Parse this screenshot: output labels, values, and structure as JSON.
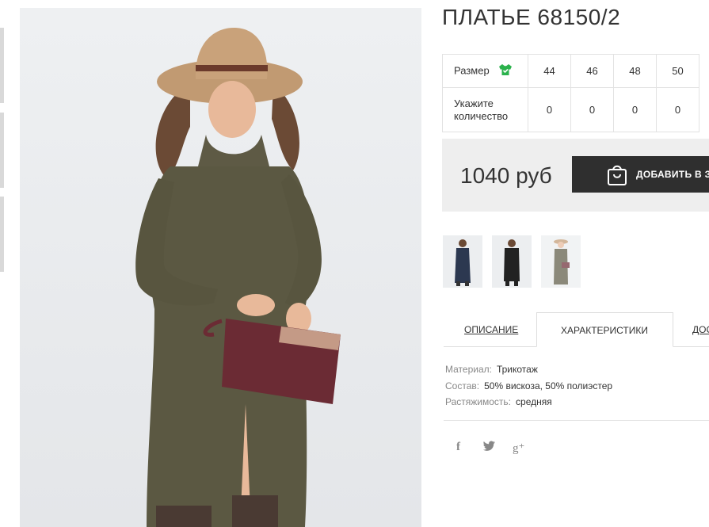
{
  "product": {
    "title": "ПЛАТЬЕ 68150/2",
    "price": "1040 руб",
    "add_to_cart_label": "ДОБАВИТЬ В ЗАКАЗ"
  },
  "size_table": {
    "size_label": "Размер",
    "quantity_label": "Укажите количество",
    "sizes": [
      "44",
      "46",
      "48",
      "50"
    ],
    "quantities": [
      "0",
      "0",
      "0",
      "0"
    ]
  },
  "tabs": {
    "description": "ОПИСАНИЕ",
    "characteristics": "ХАРАКТЕРИСТИКИ",
    "delivery": "ДОС"
  },
  "characteristics": [
    {
      "key": "Материал:",
      "value": "Трикотаж"
    },
    {
      "key": "Состав:",
      "value": "50% вискоза, 50% полиэстер"
    },
    {
      "key": "Растяжимость:",
      "value": "средняя"
    }
  ],
  "social": {
    "facebook": "f",
    "twitter": "🐦",
    "googleplus": "g⁺"
  },
  "icons": {
    "size_chart": "tshirt-icon",
    "cart": "shopping-bag-icon",
    "facebook": "facebook-icon",
    "twitter": "twitter-icon",
    "googleplus": "google-plus-icon"
  },
  "colors": {
    "accent_green": "#2bb24c",
    "button_dark": "#2f2f2f",
    "price_bg": "#eeeeee"
  }
}
